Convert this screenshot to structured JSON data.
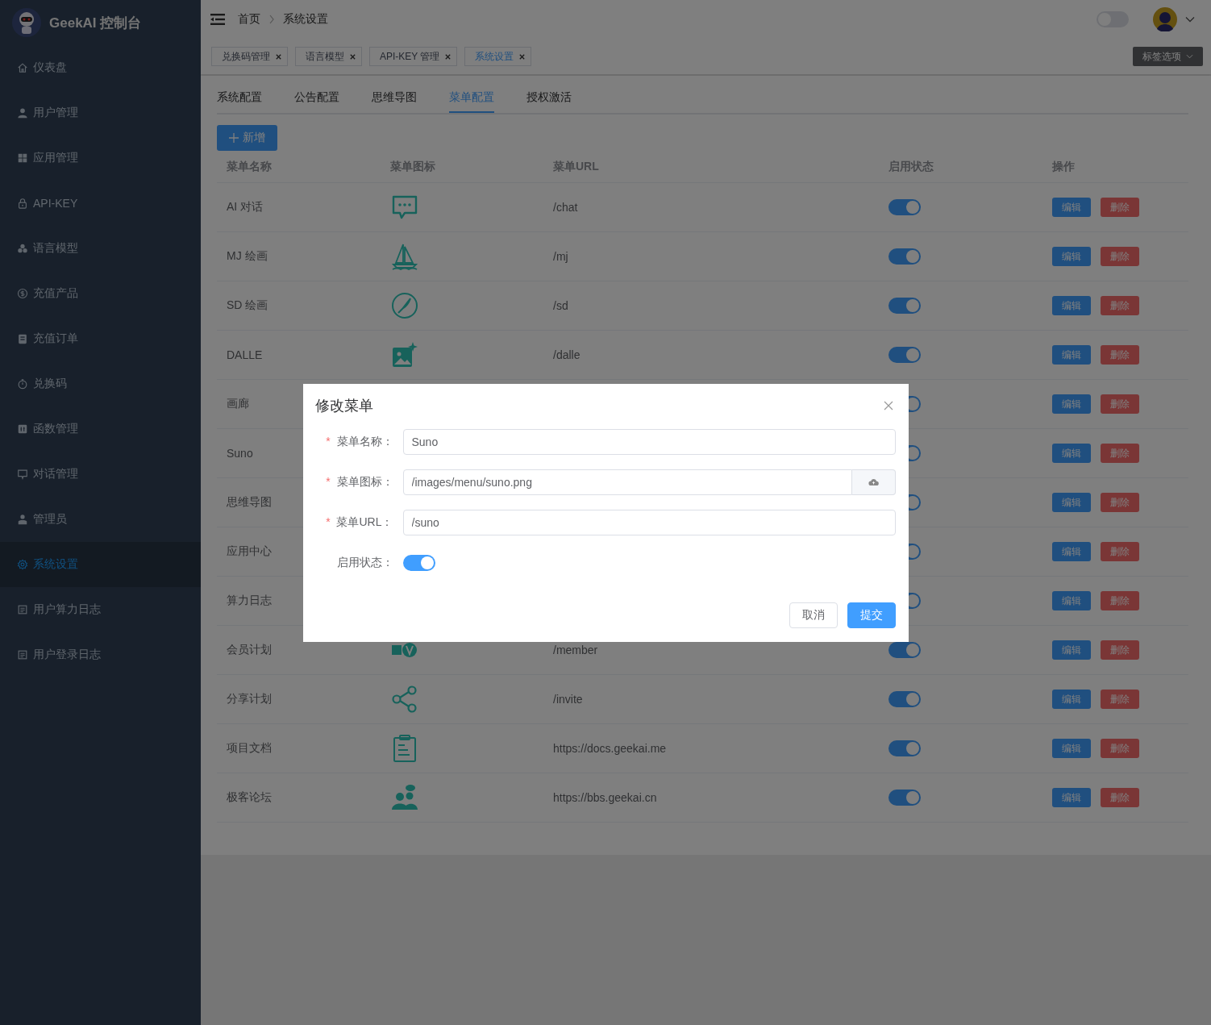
{
  "sidebar": {
    "title": "GeekAI 控制台",
    "items": [
      {
        "label": "仪表盘",
        "kind": "home",
        "selected": false
      },
      {
        "label": "用户管理",
        "kind": "user",
        "selected": false
      },
      {
        "label": "应用管理",
        "kind": "grid",
        "selected": false
      },
      {
        "label": "API-KEY",
        "kind": "lock",
        "selected": false
      },
      {
        "label": "语言模型",
        "kind": "cubes",
        "selected": false
      },
      {
        "label": "充值产品",
        "kind": "coin",
        "selected": false
      },
      {
        "label": "充值订单",
        "kind": "order",
        "selected": false
      },
      {
        "label": "兑换码",
        "kind": "timer",
        "selected": false
      },
      {
        "label": "函数管理",
        "kind": "function",
        "selected": false
      },
      {
        "label": "对话管理",
        "kind": "chat",
        "selected": false
      },
      {
        "label": "管理员",
        "kind": "admin",
        "selected": false
      },
      {
        "label": "系统设置",
        "kind": "gear",
        "selected": true
      },
      {
        "label": "用户算力日志",
        "kind": "log",
        "selected": false
      },
      {
        "label": "用户登录日志",
        "kind": "log",
        "selected": false
      }
    ]
  },
  "header": {
    "breadcrumb": [
      "首页",
      "系统设置"
    ],
    "dark_mode": false
  },
  "tag_tabs": [
    {
      "label": "兑换码管理",
      "selected": false
    },
    {
      "label": "语言模型",
      "selected": false
    },
    {
      "label": "API-KEY 管理",
      "selected": false
    },
    {
      "label": "系统设置",
      "selected": true
    }
  ],
  "tag_options": "标签选项",
  "settings_tabs": [
    {
      "label": "系统配置",
      "selected": false
    },
    {
      "label": "公告配置",
      "selected": false
    },
    {
      "label": "思维导图",
      "selected": false
    },
    {
      "label": "菜单配置",
      "selected": true
    },
    {
      "label": "授权激活",
      "selected": false
    }
  ],
  "add_button": "新增",
  "table": {
    "columns": [
      "菜单名称",
      "菜单图标",
      "菜单URL",
      "启用状态",
      "操作"
    ],
    "rows": [
      {
        "name": "AI 对话",
        "kind": "chat",
        "url": "/chat",
        "enabled": true,
        "actions": [
          "编辑",
          "删除"
        ]
      },
      {
        "name": "MJ 绘画",
        "kind": "sailboat",
        "url": "/mj",
        "enabled": true,
        "actions": [
          "编辑",
          "删除"
        ]
      },
      {
        "name": "SD 绘画",
        "kind": "brush",
        "url": "/sd",
        "enabled": true,
        "actions": [
          "编辑",
          "删除"
        ]
      },
      {
        "name": "DALLE",
        "kind": "image",
        "url": "/dalle",
        "enabled": true,
        "actions": [
          "编辑",
          "删除"
        ]
      },
      {
        "name": "画廊",
        "enabled": true,
        "actions": [
          "编辑",
          "删除"
        ]
      },
      {
        "name": "Suno",
        "enabled": true,
        "actions": [
          "编辑",
          "删除"
        ]
      },
      {
        "name": "思维导图",
        "enabled": true,
        "actions": [
          "编辑",
          "删除"
        ]
      },
      {
        "name": "应用中心",
        "enabled": true,
        "actions": [
          "编辑",
          "删除"
        ]
      },
      {
        "name": "算力日志",
        "enabled": true,
        "actions": [
          "编辑",
          "删除"
        ]
      },
      {
        "name": "会员计划",
        "kind": "member",
        "url": "/member",
        "enabled": true,
        "actions": [
          "编辑",
          "删除"
        ]
      },
      {
        "name": "分享计划",
        "kind": "share",
        "url": "/invite",
        "enabled": true,
        "actions": [
          "编辑",
          "删除"
        ]
      },
      {
        "name": "项目文档",
        "kind": "doc",
        "url": "https://docs.geekai.me",
        "enabled": true,
        "actions": [
          "编辑",
          "删除"
        ]
      },
      {
        "name": "极客论坛",
        "kind": "people",
        "url": "https://bbs.geekai.cn",
        "enabled": true,
        "actions": [
          "编辑",
          "删除"
        ]
      }
    ]
  },
  "dialog": {
    "title": "修改菜单",
    "fields": [
      {
        "kind": "text",
        "required_mark": "*",
        "label": "菜单名称：",
        "value": "Suno"
      },
      {
        "kind": "upload",
        "required_mark": "*",
        "label": "菜单图标：",
        "value": "/images/menu/suno.png"
      },
      {
        "kind": "text",
        "required_mark": "*",
        "label": "菜单URL：",
        "value": "/suno"
      },
      {
        "kind": "switch",
        "label": "启用状态：",
        "on": true
      }
    ],
    "buttons": [
      "取消",
      "提交"
    ]
  }
}
